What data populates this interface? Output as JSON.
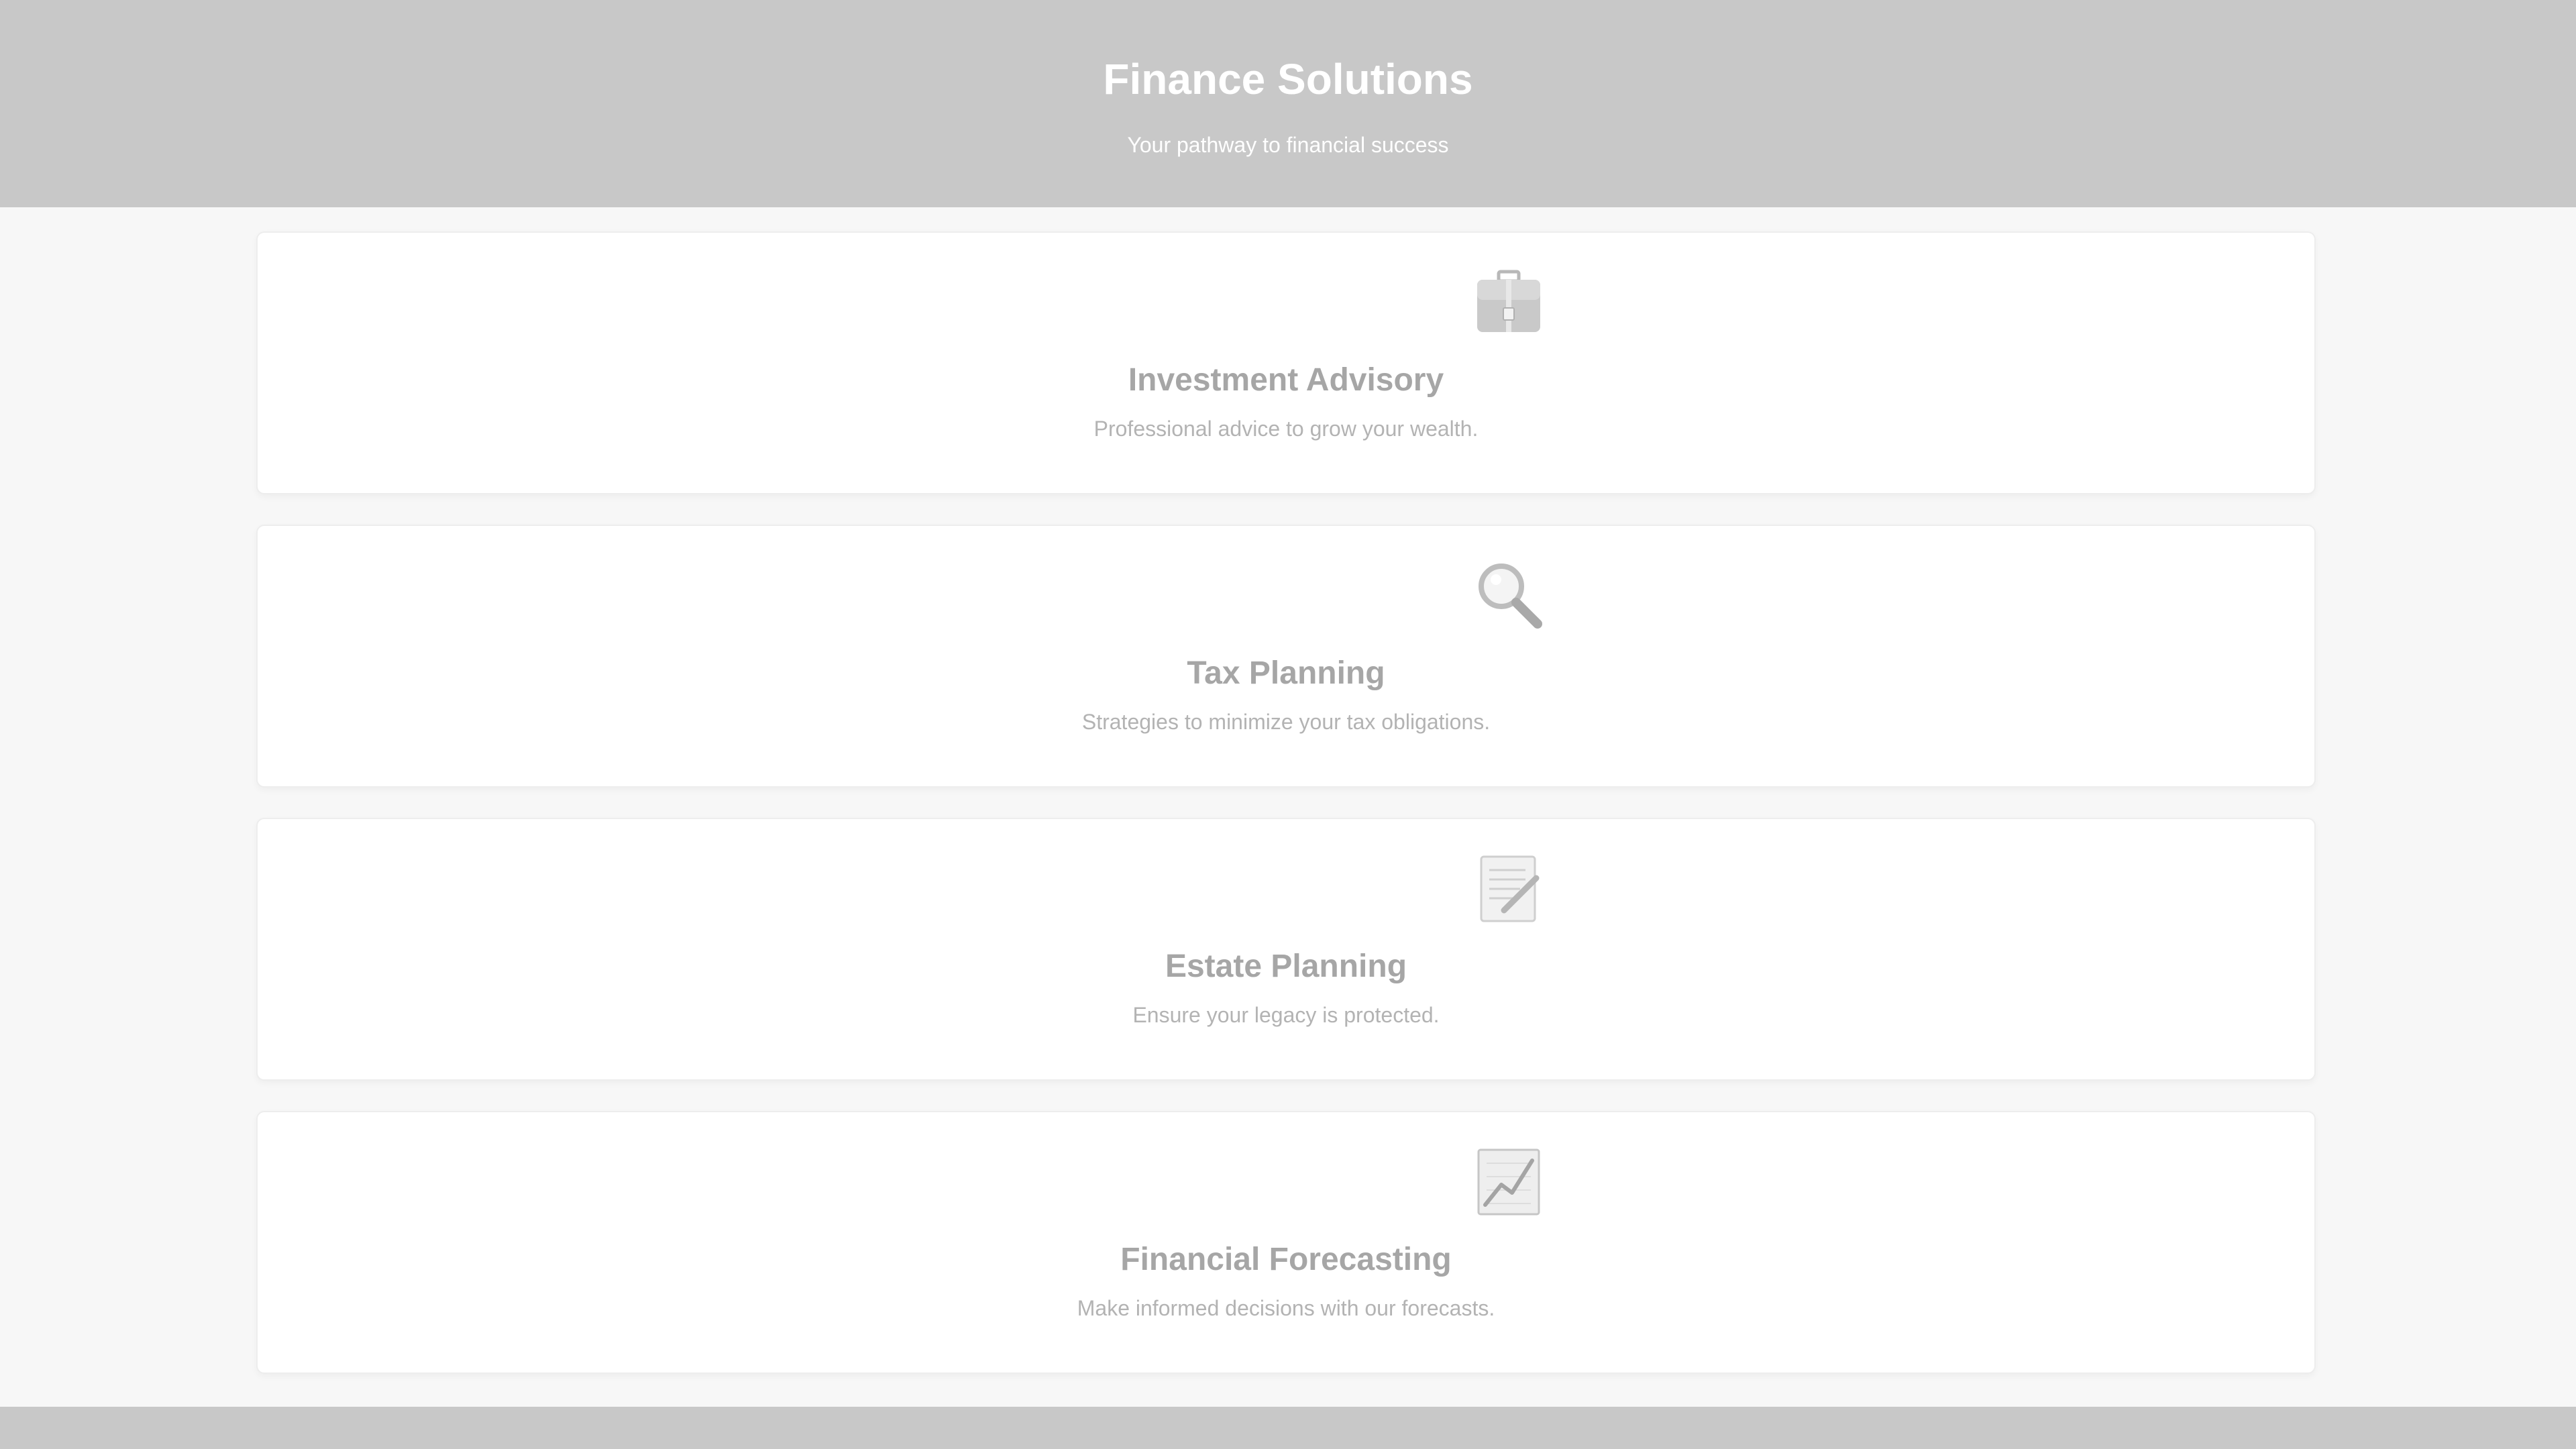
{
  "header": {
    "title": "Finance Solutions",
    "subtitle": "Your pathway to financial success"
  },
  "services": [
    {
      "icon": "briefcase-icon",
      "title": "Investment Advisory",
      "description": "Professional advice to grow your wealth."
    },
    {
      "icon": "magnifying-glass-icon",
      "title": "Tax Planning",
      "description": "Strategies to minimize your tax obligations."
    },
    {
      "icon": "document-pencil-icon",
      "title": "Estate Planning",
      "description": "Ensure your legacy is protected."
    },
    {
      "icon": "chart-line-icon",
      "title": "Financial Forecasting",
      "description": "Make informed decisions with our forecasts."
    }
  ],
  "colors": {
    "header_bg": "#c8c8c8",
    "page_bg": "#f7f7f7",
    "card_bg": "#ffffff",
    "title_text": "#a6a6a6",
    "desc_text": "#b3b3b3"
  }
}
